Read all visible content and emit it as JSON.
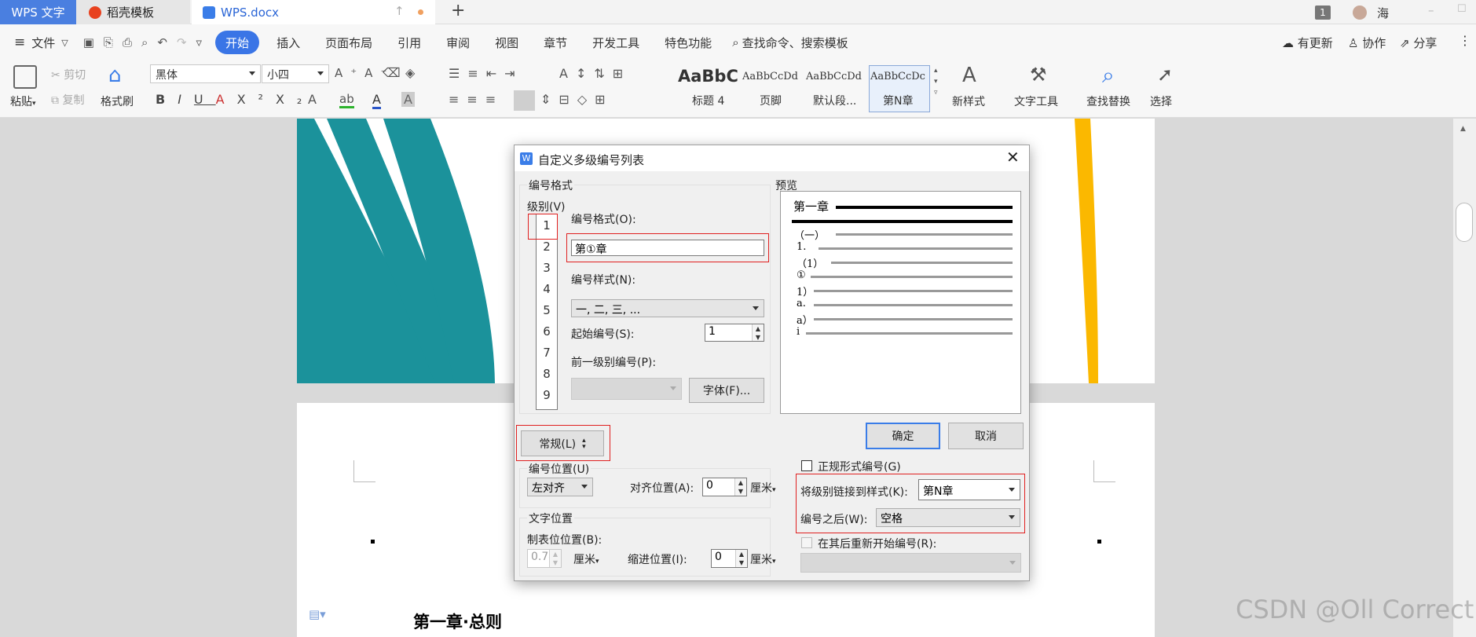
{
  "titlebar": {
    "app_tab": "WPS 文字",
    "template_tab": "稻壳模板",
    "doc_tab": "WPS.docx",
    "new_tab": "+",
    "count": "1",
    "user": "海"
  },
  "menu": {
    "file": "文件",
    "items": [
      "开始",
      "插入",
      "页面布局",
      "引用",
      "审阅",
      "视图",
      "章节",
      "开发工具",
      "特色功能"
    ],
    "search": "查找命令、搜索模板",
    "update": "有更新",
    "collab": "协作",
    "share": "分享"
  },
  "ribbon": {
    "paste": "粘贴",
    "cut": "剪切",
    "copy": "复制",
    "format_painter": "格式刷",
    "font": "黑体",
    "size": "小四",
    "styles": [
      {
        "preview": "AaBbC",
        "name": "标题 4"
      },
      {
        "preview": "AaBbCcDd",
        "name": "页脚"
      },
      {
        "preview": "AaBbCcDd",
        "name": "默认段..."
      },
      {
        "preview": "AaBbCcDc",
        "name": "第N章"
      }
    ],
    "new_style": "新样式",
    "text_tools": "文字工具",
    "find_replace": "查找替换",
    "select": "选择"
  },
  "dialog": {
    "title": "自定义多级编号列表",
    "format_group": "编号格式",
    "level_label": "级别(V)",
    "levels": [
      "1",
      "2",
      "3",
      "4",
      "5",
      "6",
      "7",
      "8",
      "9"
    ],
    "number_format_label": "编号格式(O):",
    "number_format_value": "第①章",
    "number_style_label": "编号样式(N):",
    "number_style_value": "一, 二, 三, ...",
    "start_label": "起始编号(S):",
    "start_value": "1",
    "prev_level_label": "前一级别编号(P):",
    "font_button": "字体(F)...",
    "preview_label": "预览",
    "preview_lines": [
      "第一章",
      "（一）",
      "1.",
      "（1）",
      "①",
      "1）",
      "a.",
      "a）",
      "i"
    ],
    "normal_button": "常规(L)",
    "ok_button": "确定",
    "cancel_button": "取消",
    "position_group": "编号位置(U)",
    "align_value": "左对齐",
    "align_pos_label": "对齐位置(A):",
    "align_pos_value": "0",
    "unit": "厘米",
    "text_group": "文字位置",
    "tab_pos_label": "制表位位置(B):",
    "tab_pos_value": "0.74",
    "indent_label": "缩进位置(I):",
    "indent_value": "0",
    "legal_label": "正规形式编号(G)",
    "link_label": "将级别链接到样式(K):",
    "link_value": "第N章",
    "after_label": "编号之后(W):",
    "after_value": "空格",
    "restart_label": "在其后重新开始编号(R):"
  },
  "doc": {
    "heading": "第一章·总则"
  },
  "watermark": "CSDN @Oll Correct"
}
